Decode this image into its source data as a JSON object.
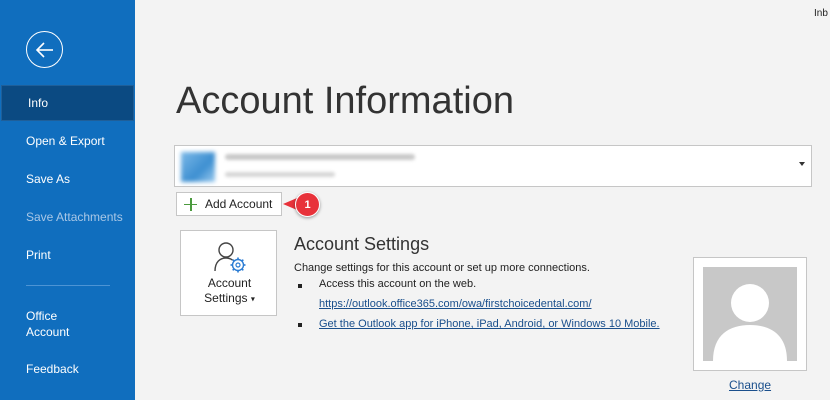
{
  "window": {
    "corner_text": "Inb"
  },
  "sidebar": {
    "items": [
      {
        "label": "Info",
        "state": "active"
      },
      {
        "label": "Open & Export",
        "state": "normal"
      },
      {
        "label": "Save As",
        "state": "normal"
      },
      {
        "label": "Save Attachments",
        "state": "disabled"
      },
      {
        "label": "Print",
        "state": "normal"
      },
      {
        "label_line1": "Office",
        "label_line2": "Account",
        "state": "normal"
      },
      {
        "label": "Feedback",
        "state": "normal"
      }
    ]
  },
  "main": {
    "title": "Account Information",
    "add_account": {
      "label": "Add Account"
    },
    "callout": {
      "number": "1"
    },
    "account_settings": {
      "tile_label_line1": "Account",
      "tile_label_line2": "Settings",
      "tile_caret": "▾",
      "title": "Account Settings",
      "description": "Change settings for this account or set up more connections.",
      "bullet1": "Access this account on the web.",
      "bullet1_link": "https://outlook.office365.com/owa/firstchoicedental.com/",
      "bullet2_link": "Get the Outlook app for iPhone, iPad, Android, or Windows 10 Mobile."
    },
    "profile": {
      "change_label": "Change"
    }
  },
  "colors": {
    "sidebar": "#106ebe",
    "sidebar_active": "#0b4a82",
    "link": "#1a4f8c",
    "badge": "#e8323a",
    "plus": "#4b9a3e"
  },
  "icons": {
    "back": "back-arrow-icon",
    "add": "plus-icon",
    "settings": "person-gear-icon",
    "profile": "default-avatar-icon"
  }
}
